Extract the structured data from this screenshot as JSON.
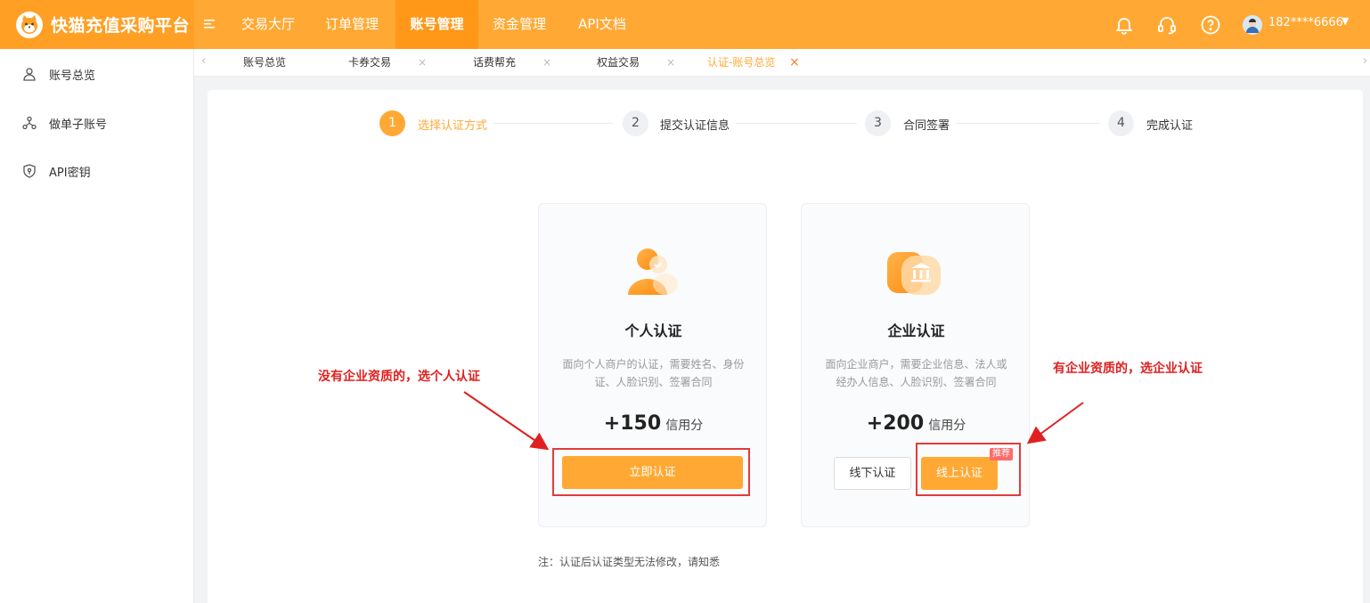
{
  "app": {
    "title": "快猫充值采购平台",
    "accent": "#ffa934"
  },
  "header": {
    "nav": [
      {
        "label": "交易大厅",
        "active": false
      },
      {
        "label": "订单管理",
        "active": false
      },
      {
        "label": "账号管理",
        "active": true
      },
      {
        "label": "资金管理",
        "active": false
      },
      {
        "label": "API文档",
        "active": false
      }
    ],
    "icons": [
      "bell-icon",
      "headset-icon",
      "help-icon"
    ],
    "user": {
      "name": "182****6666"
    }
  },
  "sidebar": {
    "items": [
      {
        "label": "账号总览",
        "icon": "user-icon"
      },
      {
        "label": "做单子账号",
        "icon": "sub-account-icon"
      },
      {
        "label": "API密钥",
        "icon": "key-shield-icon"
      }
    ]
  },
  "tabs": [
    {
      "label": "账号总览",
      "closable": false,
      "active": false
    },
    {
      "label": "卡券交易",
      "closable": true,
      "active": false
    },
    {
      "label": "话费帮充",
      "closable": true,
      "active": false
    },
    {
      "label": "权益交易",
      "closable": true,
      "active": false
    },
    {
      "label": "认证-账号总览",
      "closable": true,
      "active": true
    }
  ],
  "steps": [
    {
      "num": "1",
      "label": "选择认证方式",
      "active": true
    },
    {
      "num": "2",
      "label": "提交认证信息",
      "active": false
    },
    {
      "num": "3",
      "label": "合同签署",
      "active": false
    },
    {
      "num": "4",
      "label": "完成认证",
      "active": false
    }
  ],
  "cards": {
    "personal": {
      "title": "个人认证",
      "desc": "面向个人商户的认证，需要姓名、身份证、人脸识别、签署合同",
      "credit": "+150",
      "credit_unit": "信用分",
      "button": "立即认证"
    },
    "enterprise": {
      "title": "企业认证",
      "desc": "面向企业商户，需要企业信息、法人或经办人信息、人脸识别、签署合同",
      "credit": "+200",
      "credit_unit": "信用分",
      "offline_button": "线下认证",
      "online_button": "线上认证",
      "badge": "推荐"
    }
  },
  "annotations": {
    "left": "没有企业资质的，选个人认证",
    "right": "有企业资质的，选企业认证"
  },
  "note": "注：认证后认证类型无法修改，请知悉"
}
